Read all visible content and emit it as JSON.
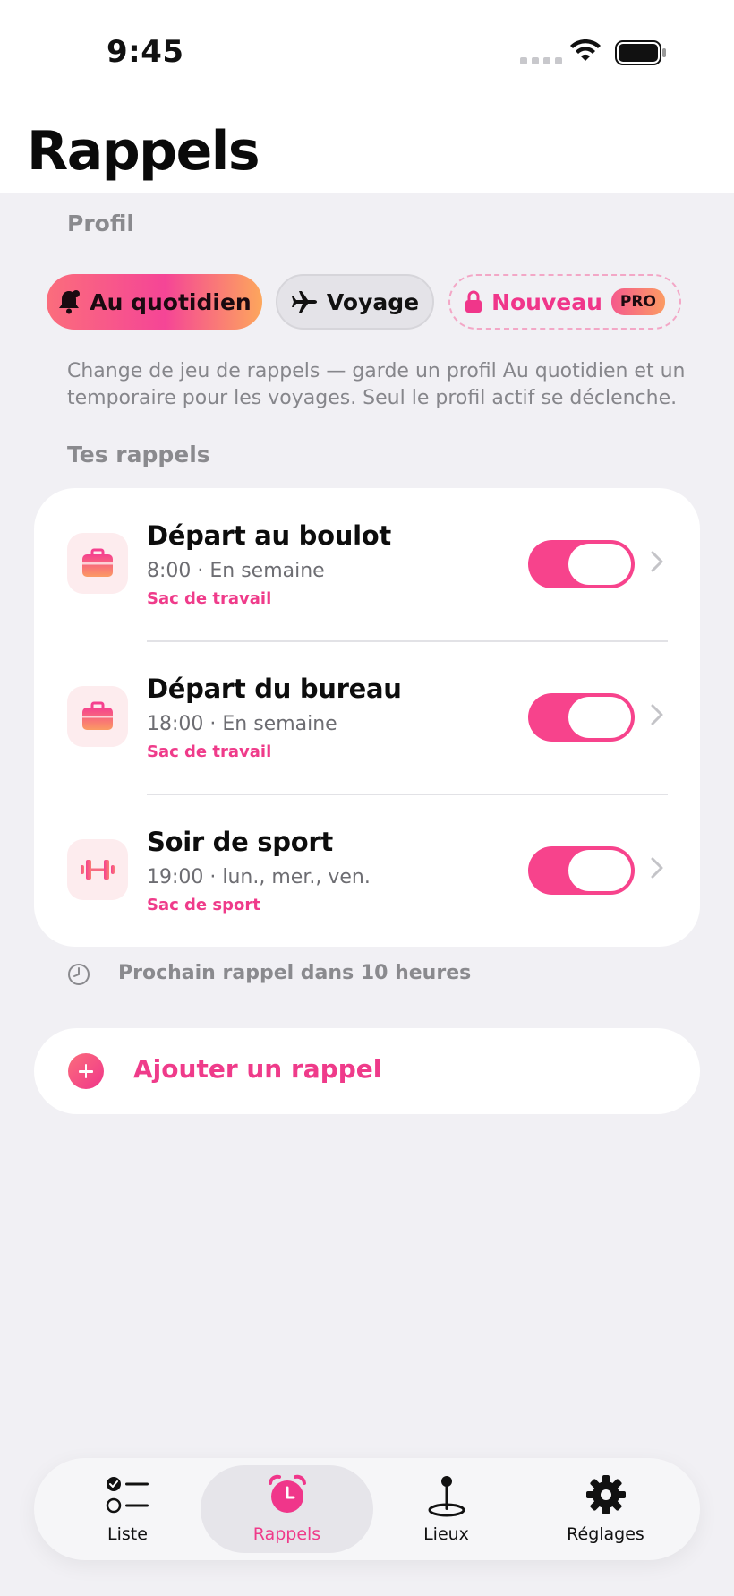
{
  "status_bar": {
    "time": "9:45"
  },
  "header": {
    "title": "Rappels"
  },
  "profile": {
    "section_label": "Profil",
    "chips": [
      {
        "label": "Au quotidien",
        "icon": "bell-icon",
        "selected": true
      },
      {
        "label": "Voyage",
        "icon": "airplane-icon",
        "selected": false
      },
      {
        "label": "Nouveau",
        "icon": "lock-icon",
        "badge": "PRO",
        "locked": true
      }
    ],
    "description": "Change de jeu de rappels — garde un profil Au quotidien et un temporaire pour les voyages. Seul le profil actif se déclenche."
  },
  "reminders": {
    "section_label": "Tes rappels",
    "items": [
      {
        "title": "Départ au boulot",
        "meta": "8:00 · En semaine",
        "bag": "Sac de travail",
        "icon": "briefcase-icon",
        "enabled": true
      },
      {
        "title": "Départ du bureau",
        "meta": "18:00 · En semaine",
        "bag": "Sac de travail",
        "icon": "briefcase-icon",
        "enabled": true
      },
      {
        "title": "Soir de sport",
        "meta": "19:00 · lun., mer., ven.",
        "bag": "Sac de sport",
        "icon": "dumbbell-icon",
        "enabled": true
      }
    ],
    "next_reminder": "Prochain rappel dans 10 heures"
  },
  "add_reminder": {
    "label": "Ajouter un rappel"
  },
  "tabbar": {
    "tabs": [
      {
        "label": "Liste",
        "icon": "checklist-icon",
        "active": false
      },
      {
        "label": "Rappels",
        "icon": "alarm-clock-icon",
        "active": true
      },
      {
        "label": "Lieux",
        "icon": "map-pin-icon",
        "active": false
      },
      {
        "label": "Réglages",
        "icon": "gear-icon",
        "active": false
      }
    ]
  },
  "colors": {
    "accent": "#f0368a",
    "toggle_on": "#f7438c",
    "background": "#f1f0f4",
    "card": "#ffffff",
    "secondary_text": "#8a8a8e"
  }
}
